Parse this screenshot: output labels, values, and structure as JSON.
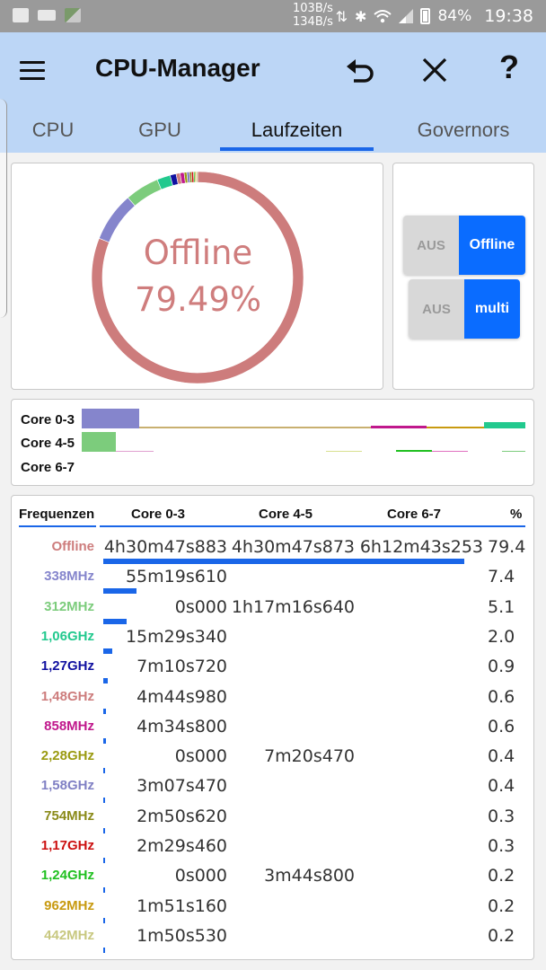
{
  "status_bar": {
    "net_down": "103B/s",
    "net_up": "134B/s",
    "battery": "84%",
    "time": "19:38",
    "icons": [
      "image-icon",
      "video-icon",
      "gallery-icon",
      "data-arrows-icon",
      "bluetooth-icon",
      "wifi-icon",
      "signal-icon",
      "battery-icon"
    ]
  },
  "app": {
    "title": "CPU-Manager",
    "actions": [
      "menu-icon",
      "undo-icon",
      "close-icon",
      "help-icon"
    ],
    "help_glyph": "?"
  },
  "tabs": [
    {
      "label": "CPU"
    },
    {
      "label": "GPU"
    },
    {
      "label": "Laufzeiten",
      "active": true
    },
    {
      "label": "Governors"
    }
  ],
  "donut": {
    "center_title": "Offline",
    "center_value": "79.49%",
    "colors": {
      "Offline": "#cd7c7c",
      "338MHz": "#8585cc",
      "312MHz": "#7ccc7c",
      "1,06GHz": "#22c98e",
      "1,27GHz": "#1010a0",
      "1,48GHz": "#cd7c7c",
      "858MHz": "#c0188c",
      "2,28GHz": "#9a9a10",
      "1,58GHz": "#8080c4",
      "754MHz": "#8a8a18",
      "1,17GHz": "#cc1010",
      "1,24GHz": "#20c020",
      "962MHz": "#c89a10",
      "442MHz": "#c8c880"
    },
    "slices": [
      {
        "name": "Offline",
        "percent": 79.49
      },
      {
        "name": "338MHz",
        "percent": 7.4
      },
      {
        "name": "312MHz",
        "percent": 5.1
      },
      {
        "name": "1,06GHz",
        "percent": 2.0
      },
      {
        "name": "1,27GHz",
        "percent": 0.9
      },
      {
        "name": "1,48GHz",
        "percent": 0.6
      },
      {
        "name": "858MHz",
        "percent": 0.6
      },
      {
        "name": "2,28GHz",
        "percent": 0.4
      },
      {
        "name": "1,58GHz",
        "percent": 0.4
      },
      {
        "name": "754MHz",
        "percent": 0.3
      },
      {
        "name": "1,17GHz",
        "percent": 0.3
      },
      {
        "name": "1,24GHz",
        "percent": 0.2
      },
      {
        "name": "962MHz",
        "percent": 0.2
      },
      {
        "name": "442MHz",
        "percent": 0.2
      }
    ]
  },
  "toggles": [
    {
      "off_label": "AUS",
      "on_label": "Offline"
    },
    {
      "off_label": "AUS",
      "on_label": "multi"
    }
  ],
  "core_bars": [
    {
      "label": "Core 0-3"
    },
    {
      "label": "Core 4-5"
    },
    {
      "label": "Core 6-7"
    }
  ],
  "table": {
    "headers": [
      "Frequenzen",
      "Core 0-3",
      "Core 4-5",
      "Core 6-7",
      "%"
    ],
    "rows": [
      {
        "freq": "Offline",
        "color": "#cd7c7c",
        "c0": "4h30m47s883",
        "c1": "4h30m47s873",
        "c2": "6h12m43s253",
        "pct": "79.4",
        "share": 0.795
      },
      {
        "freq": "338MHz",
        "color": "#8585cc",
        "c0": "55m19s610",
        "c1": "",
        "c2": "",
        "pct": "7.4",
        "share": 0.074
      },
      {
        "freq": "312MHz",
        "color": "#7ccc7c",
        "c0": "0s000",
        "c1": "1h17m16s640",
        "c2": "",
        "pct": "5.1",
        "share": 0.051
      },
      {
        "freq": "1,06GHz",
        "color": "#22c98e",
        "c0": "15m29s340",
        "c1": "",
        "c2": "",
        "pct": "2.0",
        "share": 0.02
      },
      {
        "freq": "1,27GHz",
        "color": "#1010a0",
        "c0": "7m10s720",
        "c1": "",
        "c2": "",
        "pct": "0.9",
        "share": 0.009
      },
      {
        "freq": "1,48GHz",
        "color": "#cd7c7c",
        "c0": "4m44s980",
        "c1": "",
        "c2": "",
        "pct": "0.6",
        "share": 0.006
      },
      {
        "freq": "858MHz",
        "color": "#c0188c",
        "c0": "4m34s800",
        "c1": "",
        "c2": "",
        "pct": "0.6",
        "share": 0.006
      },
      {
        "freq": "2,28GHz",
        "color": "#9a9a10",
        "c0": "0s000",
        "c1": "7m20s470",
        "c2": "",
        "pct": "0.4",
        "share": 0.004
      },
      {
        "freq": "1,58GHz",
        "color": "#8080c4",
        "c0": "3m07s470",
        "c1": "",
        "c2": "",
        "pct": "0.4",
        "share": 0.004
      },
      {
        "freq": "754MHz",
        "color": "#8a8a18",
        "c0": "2m50s620",
        "c1": "",
        "c2": "",
        "pct": "0.3",
        "share": 0.003
      },
      {
        "freq": "1,17GHz",
        "color": "#cc1010",
        "c0": "2m29s460",
        "c1": "",
        "c2": "",
        "pct": "0.3",
        "share": 0.003
      },
      {
        "freq": "1,24GHz",
        "color": "#20c020",
        "c0": "0s000",
        "c1": "3m44s800",
        "c2": "",
        "pct": "0.2",
        "share": 0.002
      },
      {
        "freq": "962MHz",
        "color": "#c89a10",
        "c0": "1m51s160",
        "c1": "",
        "c2": "",
        "pct": "0.2",
        "share": 0.002
      },
      {
        "freq": "442MHz",
        "color": "#c8c880",
        "c0": "1m50s530",
        "c1": "",
        "c2": "",
        "pct": "0.2",
        "share": 0.002
      }
    ]
  }
}
